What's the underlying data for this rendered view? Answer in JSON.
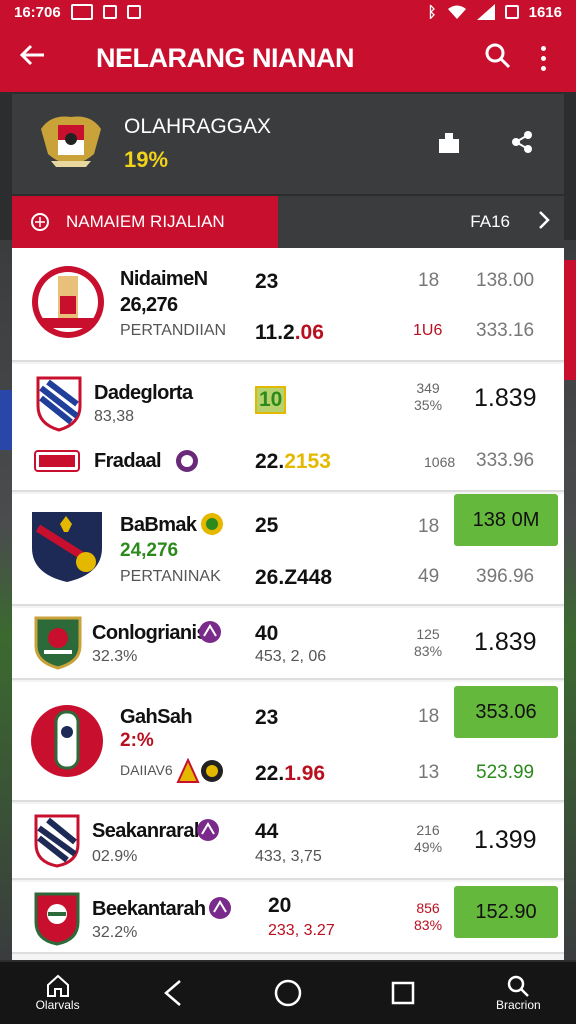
{
  "status_bar": {
    "time": "16:706",
    "right_time": "1616"
  },
  "app_bar": {
    "title": "NELARANG NIANAN"
  },
  "header": {
    "name": "OLAHRAGGAX",
    "percent": "19%"
  },
  "subheader": {
    "left_label": "NAMAIEM RIJALIAN",
    "right_label": "FA16"
  },
  "rows": [
    {
      "name": "NidaimeN",
      "sub1": "26,276",
      "sub2": "PERTANDIIAN",
      "num1": "23",
      "num2a": "11.2",
      "num2b": ".06",
      "col3a": "18",
      "col3b": "1U6",
      "col4a": "138.00",
      "col4b": "333.16"
    },
    {
      "name": "Dadeglorta",
      "sub1": "83,38",
      "num1": "10",
      "col3a": "349\n35%",
      "big": "1.839"
    },
    {
      "name": "Fradaal",
      "num1a": "22.",
      "num1b": "2153",
      "col3a": "1068",
      "col4a": "333.96"
    },
    {
      "name": "BaBmak",
      "sub1": "24,276",
      "sub2": "PERTANINAK",
      "num1": "25",
      "num2": "26.Z448",
      "col3a": "18",
      "col3b": "49",
      "btn": "138 0M",
      "col4b": "396.96"
    },
    {
      "name": "Conlogrianis",
      "sub1": "32.3%",
      "num1": "40",
      "num1sub": "453, 2, 06",
      "col3a": "125\n83%",
      "big": "1.839"
    },
    {
      "name": "GahSah",
      "sub1": "2:%",
      "sub2": "DAIIAV6",
      "num1": "23",
      "num2a": "22.",
      "num2b": "1.96",
      "col3a": "18",
      "col3b": "13",
      "btn": "353.06",
      "col4b": "523.99"
    },
    {
      "name": "Seakanrarah",
      "sub1": "02.9%",
      "num1": "44",
      "num1sub": "433, 3,75",
      "col3a": "216\n49%",
      "big": "1.399"
    },
    {
      "name": "Beekantarah",
      "sub1": "32.2%",
      "num1": "20",
      "num1sub": "233, 3.27",
      "col3a": "856\n83%",
      "btn": "152.90"
    }
  ],
  "nav": {
    "home_label": "Olarvals",
    "search_label": "Bracrion"
  },
  "colors": {
    "accent": "#c8102e",
    "green": "#64b83b",
    "dark": "#3a3c3e"
  }
}
